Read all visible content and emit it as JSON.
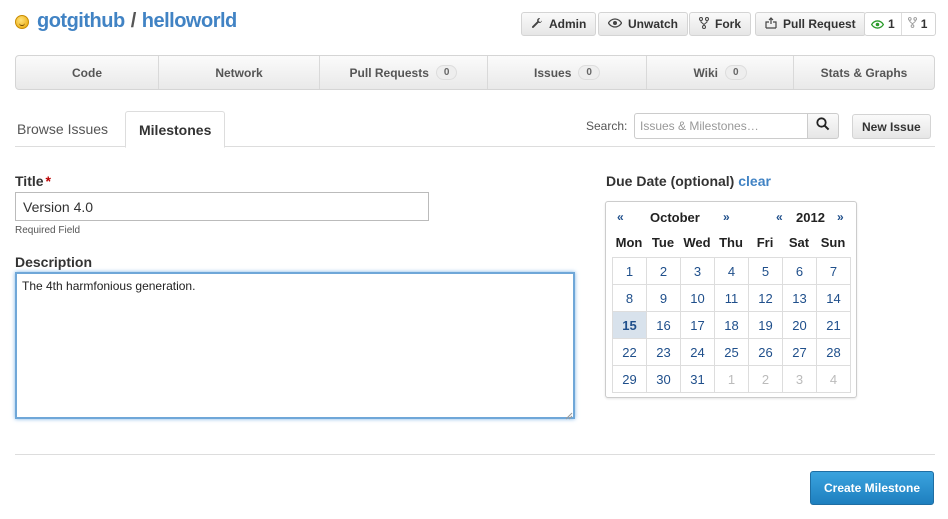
{
  "repo": {
    "owner": "gotgithub",
    "separator": "/",
    "name": "helloworld"
  },
  "actions": {
    "admin": "Admin",
    "unwatch": "Unwatch",
    "fork": "Fork",
    "pull_request": "Pull Request"
  },
  "stats": {
    "watchers": "1",
    "forks": "1"
  },
  "nav": {
    "tabs": [
      {
        "label": "Code"
      },
      {
        "label": "Network"
      },
      {
        "label": "Pull Requests",
        "count": "0"
      },
      {
        "label": "Issues",
        "count": "0"
      },
      {
        "label": "Wiki",
        "count": "0"
      },
      {
        "label": "Stats & Graphs"
      }
    ]
  },
  "subnav": {
    "browse": "Browse Issues",
    "milestones": "Milestones"
  },
  "search": {
    "label": "Search:",
    "placeholder": "Issues & Milestones…"
  },
  "new_issue": "New Issue",
  "form": {
    "title_label": "Title",
    "required_mark": "*",
    "title_value": "Version 4.0",
    "required_hint": "Required Field",
    "description_label": "Description",
    "description_value": "The 4th harmfonious generation."
  },
  "due": {
    "label": "Due Date (optional)",
    "clear": "clear",
    "prev": "«",
    "next": "»",
    "month": "October",
    "year": "2012",
    "weekdays": [
      "Mon",
      "Tue",
      "Wed",
      "Thu",
      "Fri",
      "Sat",
      "Sun"
    ],
    "weeks": [
      [
        "1",
        "2",
        "3",
        "4",
        "5",
        "6",
        "7"
      ],
      [
        "8",
        "9",
        "10",
        "11",
        "12",
        "13",
        "14"
      ],
      [
        "15",
        "16",
        "17",
        "18",
        "19",
        "20",
        "21"
      ],
      [
        "22",
        "23",
        "24",
        "25",
        "26",
        "27",
        "28"
      ],
      [
        "29",
        "30",
        "31",
        "1",
        "2",
        "3",
        "4"
      ]
    ],
    "selected": "15"
  },
  "create_button": "Create Milestone",
  "colors": {
    "link": "#4183c4",
    "primary": "#1e7fbf",
    "selected_day": "#d8e2ec"
  }
}
